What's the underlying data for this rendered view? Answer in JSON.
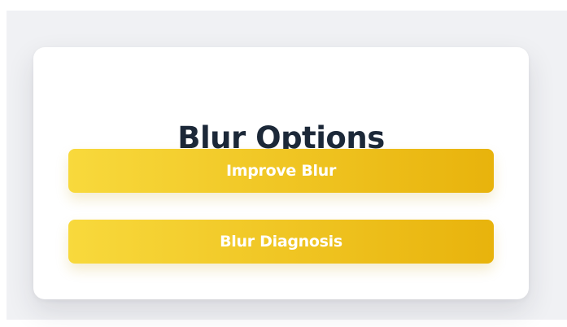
{
  "card": {
    "title": "Blur Options"
  },
  "buttons": [
    {
      "label": "Improve Blur"
    },
    {
      "label": "Blur Diagnosis"
    }
  ],
  "colors": {
    "page_background": "#f0f1f4",
    "card_background": "#ffffff",
    "title_text": "#1c2838",
    "button_gradient_start": "#f8d93c",
    "button_gradient_end": "#e8b30c",
    "button_text": "#ffffff"
  }
}
